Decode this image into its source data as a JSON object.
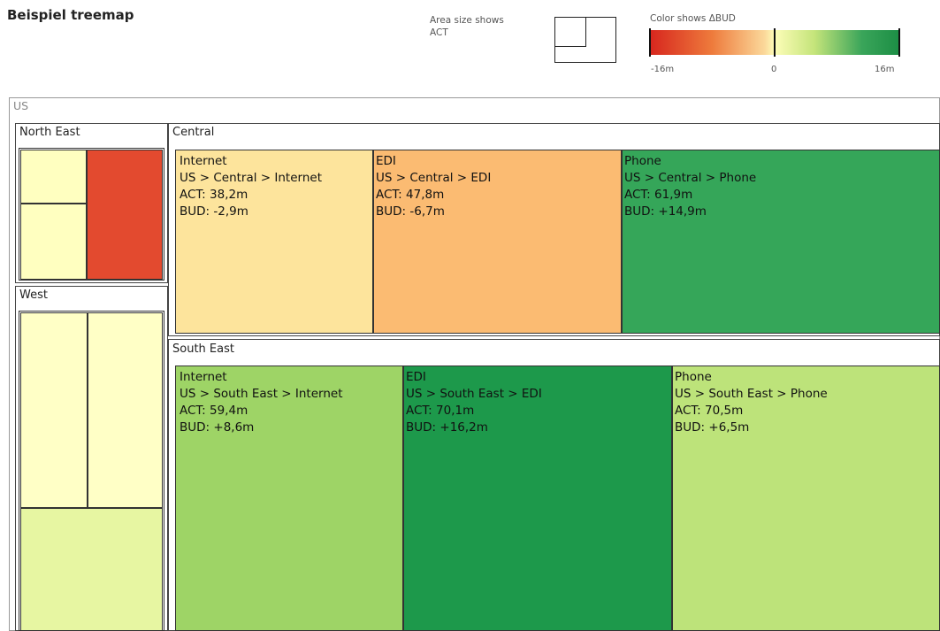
{
  "chart_data": {
    "type": "treemap",
    "title": "Beispiel treemap",
    "legend": {
      "size_label": "Area size shows",
      "size_measure": "ACT",
      "color_label": "Color shows ΔBUD",
      "color_min": "-16m",
      "color_mid": "0",
      "color_max": "16m",
      "color_scale": [
        "#d7261e",
        "#fdfdb8",
        "#1c8e45"
      ]
    },
    "root": "US",
    "regions": [
      {
        "name": "North East",
        "children": [
          {
            "color": "#ffffc0"
          },
          {
            "color": "#ffffc0"
          },
          {
            "color": "#e34a2f"
          }
        ]
      },
      {
        "name": "West",
        "children": [
          {
            "color": "#ffffc6"
          },
          {
            "color": "#ffffc6"
          },
          {
            "color": "#e7f6a2"
          }
        ]
      },
      {
        "name": "Central",
        "children": [
          {
            "name": "Internet",
            "path": "US > Central > Internet",
            "act": "ACT: 38,2m",
            "bud": "BUD: -2,9m",
            "act_value": 38.2,
            "bud_value": -2.9,
            "color": "#fde49c"
          },
          {
            "name": "EDI",
            "path": "US > Central > EDI",
            "act": "ACT: 47,8m",
            "bud": "BUD: -6,7m",
            "act_value": 47.8,
            "bud_value": -6.7,
            "color": "#fbbb72"
          },
          {
            "name": "Phone",
            "path": "US > Central > Phone",
            "act": "ACT: 61,9m",
            "bud": "BUD: +14,9m",
            "act_value": 61.9,
            "bud_value": 14.9,
            "color": "#35a659"
          }
        ]
      },
      {
        "name": "South East",
        "children": [
          {
            "name": "Internet",
            "path": "US > South East > Internet",
            "act": "ACT: 59,4m",
            "bud": "BUD: +8,6m",
            "act_value": 59.4,
            "bud_value": 8.6,
            "color": "#9ed466"
          },
          {
            "name": "EDI",
            "path": "US > South East > EDI",
            "act": "ACT: 70,1m",
            "bud": "BUD: +16,2m",
            "act_value": 70.1,
            "bud_value": 16.2,
            "color": "#1d994b"
          },
          {
            "name": "Phone",
            "path": "US > South East > Phone",
            "act": "ACT: 70,5m",
            "bud": "BUD: +6,5m",
            "act_value": 70.5,
            "bud_value": 6.5,
            "color": "#bde37a"
          }
        ]
      }
    ]
  }
}
